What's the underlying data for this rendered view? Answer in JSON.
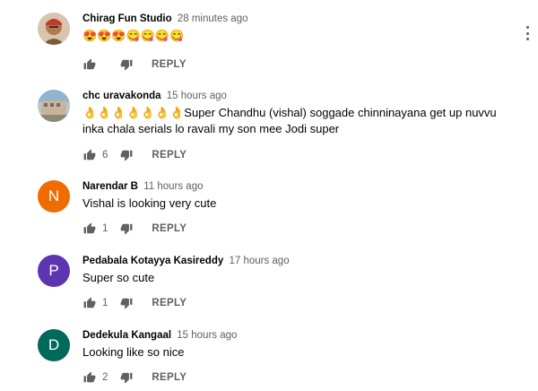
{
  "comments": [
    {
      "author": "Chirag Fun Studio",
      "time": "28 minutes ago",
      "text": "😍😍😍😋😋😋😋",
      "likes": "",
      "reply_label": "REPLY",
      "avatar_letter": "",
      "avatar_color": "#c9a27a"
    },
    {
      "author": "chc uravakonda",
      "time": "15 hours ago",
      "text": "👌👌👌👌👌👌👌Super Chandhu (vishal) soggade  chinninayana get up nuvvu  inka chala serials lo ravali my son mee Jodi super",
      "likes": "6",
      "reply_label": "REPLY",
      "avatar_letter": "",
      "avatar_color": "#a9b3b8"
    },
    {
      "author": "Narendar B",
      "time": "11 hours ago",
      "text": "Vishal is looking very cute",
      "likes": "1",
      "reply_label": "REPLY",
      "avatar_letter": "N",
      "avatar_color": "#ef6c00"
    },
    {
      "author": "Pedabala Kotayya Kasireddy",
      "time": "17 hours ago",
      "text": "Super so cute",
      "likes": "1",
      "reply_label": "REPLY",
      "avatar_letter": "P",
      "avatar_color": "#5e35b1"
    },
    {
      "author": "Dedekula Kangaal",
      "time": "15 hours ago",
      "text": "Looking like so nice",
      "likes": "2",
      "reply_label": "REPLY",
      "avatar_letter": "D",
      "avatar_color": "#00695c"
    }
  ],
  "icons": {
    "like": "thumb-up-icon",
    "dislike": "thumb-down-icon",
    "menu": "more-vert-icon"
  }
}
